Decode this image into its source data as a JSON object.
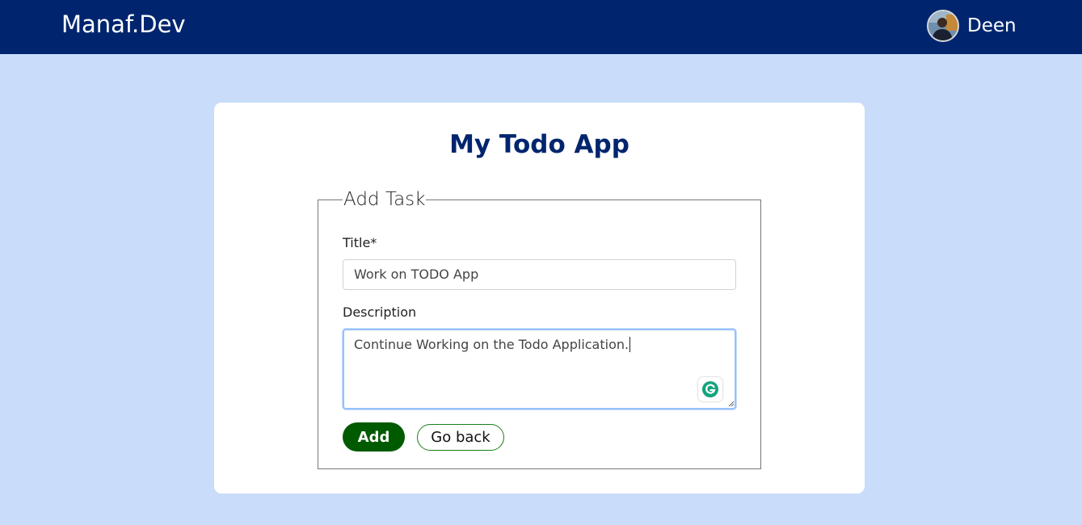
{
  "navbar": {
    "brand": "Manaf.Dev",
    "user_name": "Deen",
    "background": "#00256e"
  },
  "card": {
    "title": "My Todo App",
    "form": {
      "legend": "Add Task",
      "title_label": "Title*",
      "title_value": "Work on TODO App",
      "description_label": "Description",
      "description_value": "Continue Working on the Todo Application.",
      "add_label": "Add",
      "back_label": "Go back"
    }
  },
  "colors": {
    "page_bg": "#c9dcfa",
    "accent": "#00256e",
    "add_button": "#005a00"
  },
  "icons": {
    "avatar": "user-avatar",
    "grammarly": "grammarly-icon"
  }
}
